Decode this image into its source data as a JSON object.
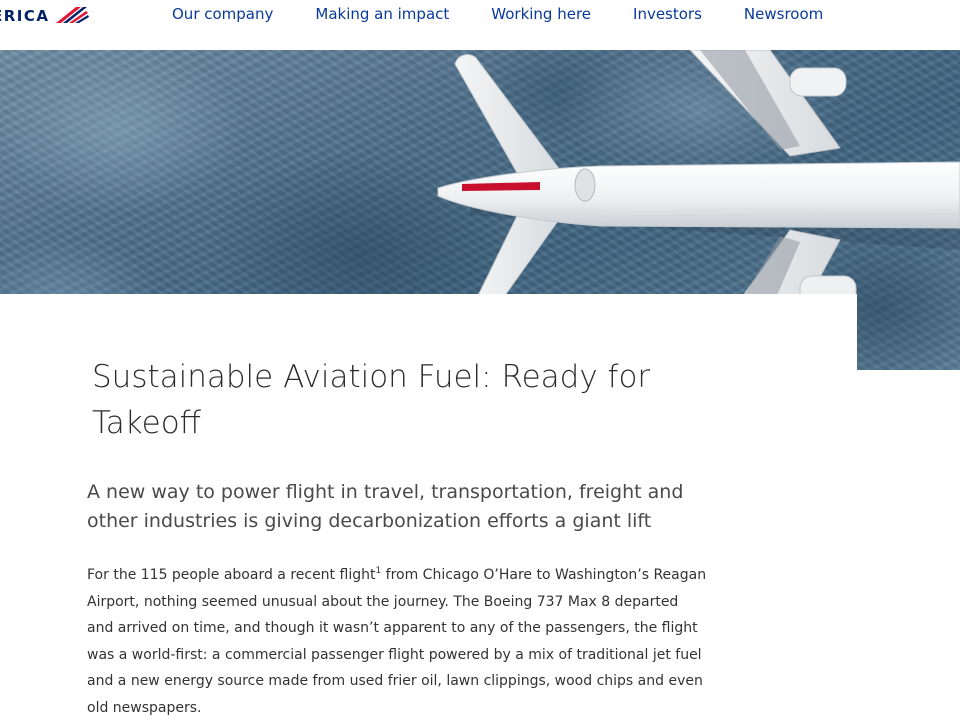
{
  "header": {
    "logo_text": "ERICA",
    "nav": [
      {
        "label": "Our company"
      },
      {
        "label": "Making an impact"
      },
      {
        "label": "Working here"
      },
      {
        "label": "Investors"
      },
      {
        "label": "Newsroom"
      }
    ]
  },
  "hero": {
    "image": "airplane-over-ocean",
    "colors": {
      "ocean": "#4d6f8a",
      "fuselage": "#f2f3f4",
      "accent_red": "#c8102e"
    }
  },
  "article": {
    "title": "Sustainable Aviation Fuel: Ready for Takeoff",
    "subtitle": "A new way to power flight in travel, transportation, freight and other industries is giving decarbonization efforts a giant lift",
    "body_before_sup": "For the 115 people aboard a recent flight",
    "footnote_marker": "1",
    "body_after_sup": " from Chicago O’Hare to Washington’s Reagan Airport, nothing seemed unusual about the journey. The Boeing 737 Max 8 departed and arrived on time, and though it wasn’t apparent to any of the passengers, the flight was a world-first: a commercial passenger flight powered by a mix of traditional jet fuel and a new energy source made from used frier oil, lawn clippings, wood chips and even old newspapers."
  },
  "colors": {
    "brand_navy": "#012169",
    "nav_link": "#0a3a99",
    "brand_red": "#e31837"
  }
}
